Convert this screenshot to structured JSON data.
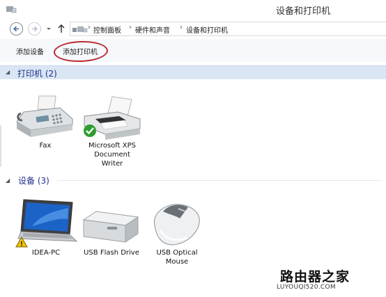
{
  "window": {
    "title": "设备和打印机"
  },
  "address_bar": {
    "breadcrumbs": [
      "控制面板",
      "硬件和声音",
      "设备和打印机"
    ],
    "separator": "›"
  },
  "toolbar": {
    "add_device_label": "添加设备",
    "add_printer_label": "添加打印机"
  },
  "groups": [
    {
      "title": "打印机 (2)",
      "collapse_glyph": "◢",
      "items": [
        {
          "label": "Fax",
          "icon": "fax-icon"
        },
        {
          "label_lines": [
            "Microsoft XPS",
            "Document",
            "Writer"
          ],
          "icon": "xps-printer-icon",
          "default_badge": "checkmark"
        }
      ]
    },
    {
      "title": "设备 (3)",
      "collapse_glyph": "◢",
      "items": [
        {
          "label": "IDEA-PC",
          "icon": "laptop-icon",
          "warning_badge": "warning"
        },
        {
          "label": "USB Flash Drive",
          "icon": "usb-drive-icon"
        },
        {
          "label_lines": [
            "USB Optical",
            "Mouse"
          ],
          "icon": "mouse-icon"
        }
      ]
    }
  ],
  "watermark": {
    "logo_text": "路由器之家",
    "url_text": "LUYOUQI520.COM"
  },
  "colors": {
    "group_header_bg": "#dbe6f4",
    "group_title": "#1e3287",
    "highlight_oval": "#b92b30"
  }
}
